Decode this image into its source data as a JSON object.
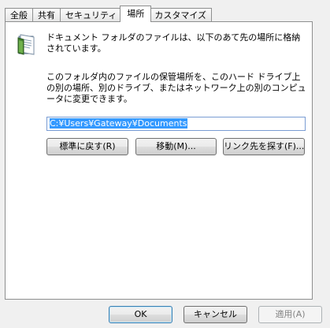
{
  "tabs": [
    {
      "label": "全般",
      "active": false
    },
    {
      "label": "共有",
      "active": false
    },
    {
      "label": "セキュリティ",
      "active": false
    },
    {
      "label": "場所",
      "active": true
    },
    {
      "label": "カスタマイズ",
      "active": false
    }
  ],
  "panel": {
    "intro_text": "ドキュメント フォルダのファイルは、以下のあて先の場所に格納されています。",
    "description_text": "このフォルダ内のファイルの保管場所を、このハード ドライブ上の別の場所、別のドライブ、またはネットワーク上の別のコンピュータに変更できます。",
    "path_value": "C:¥Users¥Gateway¥Documents",
    "restore_default_label": "標準に戻す(R)",
    "move_label": "移動(M)...",
    "find_target_label": "リンク先を探す(F)..."
  },
  "footer": {
    "ok_label": "OK",
    "cancel_label": "キャンセル",
    "apply_label": "適用(A)",
    "apply_enabled": false
  },
  "icons": {
    "folder": "documents-folder-icon"
  },
  "colors": {
    "dialog_bg": "#f0f0f0",
    "selection": "#3399ff",
    "input_border": "#7a9cd3"
  }
}
